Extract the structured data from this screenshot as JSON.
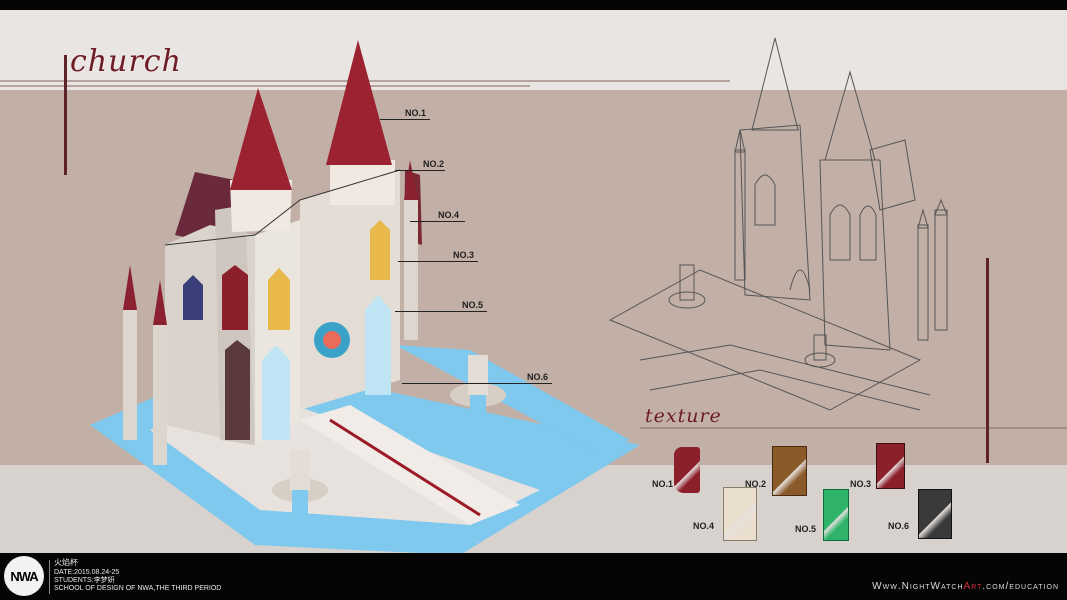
{
  "title": "church",
  "texture_heading": "texture",
  "callouts": [
    "NO.1",
    "NO.2",
    "NO.4",
    "NO.3",
    "NO.5",
    "NO.6"
  ],
  "textures": [
    {
      "label": "NO.1",
      "color": "#8b1f2b",
      "name": "red-roof-tile-swatch"
    },
    {
      "label": "NO.2",
      "color": "#8a5a2b",
      "name": "wood-block-swatch"
    },
    {
      "label": "NO.3",
      "color": "#8b1f2b",
      "name": "red-plank-swatch"
    },
    {
      "label": "NO.4",
      "color": "#eadfcf",
      "name": "stone-block-swatch"
    },
    {
      "label": "NO.5",
      "color": "#2fb36a",
      "name": "green-glass-swatch"
    },
    {
      "label": "NO.6",
      "color": "#3a3a3a",
      "name": "dark-stone-swatch"
    }
  ],
  "footer": {
    "logo": "NWA",
    "event": "火焰杯",
    "date": "DATE:2015.08.24-25",
    "students": "STUDENTS:李梦妍",
    "school": "SCHOOL OF DESIGN OF NWA,THE THIRD PERIOD",
    "site_prefix": "Www.",
    "site_mid1": "NightWatch",
    "site_red": "Art",
    "site_suffix": ".com/education"
  }
}
